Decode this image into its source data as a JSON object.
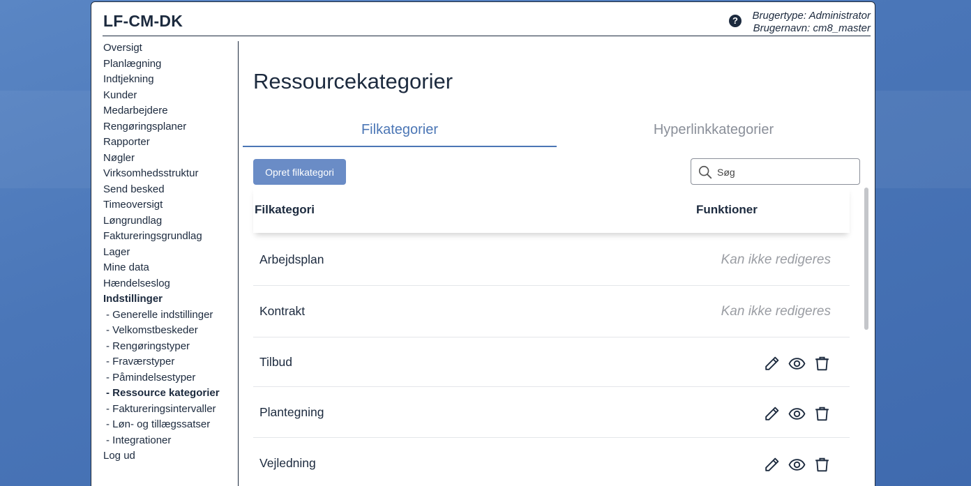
{
  "header": {
    "app_title": "LF-CM-DK",
    "user_type": "Brugertype: Administrator",
    "user_name": "Brugernavn: cm8_master",
    "help_glyph": "?"
  },
  "sidebar": {
    "items": [
      {
        "label": "Oversigt"
      },
      {
        "label": "Planlægning"
      },
      {
        "label": "Indtjekning"
      },
      {
        "label": "Kunder"
      },
      {
        "label": "Medarbejdere"
      },
      {
        "label": "Rengøringsplaner"
      },
      {
        "label": "Rapporter"
      },
      {
        "label": "Nøgler"
      },
      {
        "label": "Virksomhedsstruktur"
      },
      {
        "label": "Send besked"
      },
      {
        "label": "Timeoversigt"
      },
      {
        "label": "Løngrundlag"
      },
      {
        "label": "Faktureringsgrundlag"
      },
      {
        "label": "Lager"
      },
      {
        "label": "Mine data"
      },
      {
        "label": "Hændelseslog"
      },
      {
        "label": "Indstillinger"
      },
      {
        "label": "- Generelle indstillinger"
      },
      {
        "label": "- Velkomstbeskeder"
      },
      {
        "label": "- Rengøringstyper"
      },
      {
        "label": "- Fraværstyper"
      },
      {
        "label": "- Påmindelsestyper"
      },
      {
        "label": "- Ressource kategorier"
      },
      {
        "label": "- Faktureringsintervaller"
      },
      {
        "label": "- Løn- og tillægssatser"
      },
      {
        "label": "- Integrationer"
      },
      {
        "label": "Log ud"
      }
    ],
    "active_label": "- Ressource kategorier",
    "section_label": "Indstillinger"
  },
  "main": {
    "title": "Ressourcekategorier",
    "tabs": [
      {
        "label": "Filkategorier",
        "active": true
      },
      {
        "label": "Hyperlinkkategorier",
        "active": false
      }
    ],
    "create_button": "Opret filkategori",
    "search": {
      "placeholder": "Søg",
      "value": ""
    },
    "table": {
      "columns": [
        "Filkategori",
        "Funktioner"
      ],
      "rows": [
        {
          "name": "Arbejdsplan",
          "readonly_text": "Kan ikke redigeres"
        },
        {
          "name": "Kontrakt",
          "readonly_text": "Kan ikke redigeres"
        },
        {
          "name": "Tilbud",
          "actions": [
            "pencil-icon",
            "eye-icon",
            "trash-icon"
          ]
        },
        {
          "name": "Plantegning",
          "actions": [
            "pencil-icon",
            "eye-icon",
            "trash-icon"
          ]
        },
        {
          "name": "Vejledning",
          "actions": [
            "pencil-icon",
            "eye-icon",
            "trash-icon"
          ]
        }
      ]
    }
  },
  "colors": {
    "accent": "#4b76b5",
    "button_bg": "#6a8cc6",
    "text": "#1c2a3e",
    "muted": "#9a9da3",
    "desktop_bg": "#4a76b8"
  }
}
